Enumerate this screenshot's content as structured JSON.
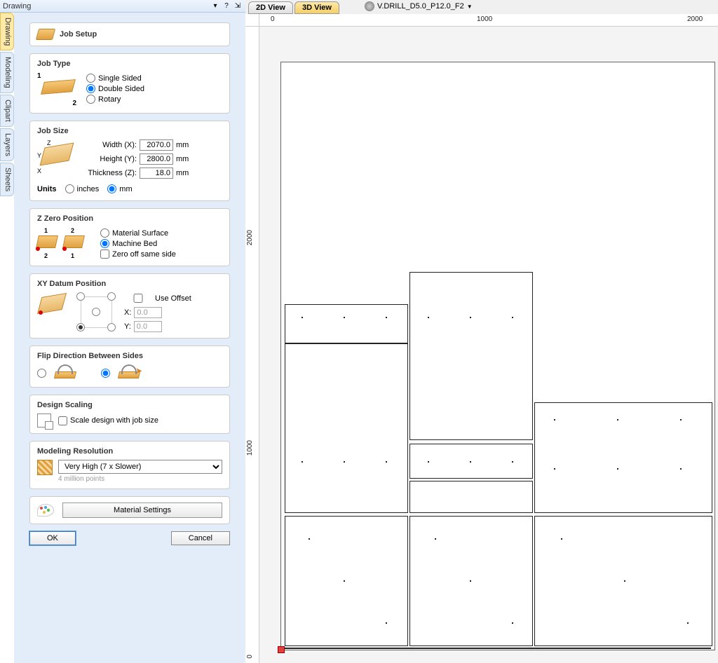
{
  "header": {
    "title": "Drawing"
  },
  "side_tabs": [
    "Drawing",
    "Modeling",
    "Clipart",
    "Layers",
    "Sheets"
  ],
  "job_setup_label": "Job Setup",
  "job_type": {
    "title": "Job Type",
    "single": "Single Sided",
    "double": "Double Sided",
    "rotary": "Rotary",
    "num1": "1",
    "num2": "2"
  },
  "job_size": {
    "title": "Job Size",
    "width_label": "Width (X):",
    "width": "2070.0",
    "height_label": "Height (Y):",
    "height": "2800.0",
    "thickness_label": "Thickness (Z):",
    "thickness": "18.0",
    "unit": "mm",
    "units_label": "Units",
    "inches": "inches",
    "mm": "mm",
    "ax_x": "X",
    "ax_y": "Y",
    "ax_z": "Z"
  },
  "z_zero": {
    "title": "Z Zero Position",
    "surface": "Material Surface",
    "bed": "Machine Bed",
    "same_side": "Zero off same side",
    "n1": "1",
    "n2": "2"
  },
  "datum": {
    "title": "XY Datum Position",
    "use_offset": "Use Offset",
    "x_label": "X:",
    "x": "0.0",
    "y_label": "Y:",
    "y": "0.0"
  },
  "flip": {
    "title": "Flip Direction Between Sides"
  },
  "scaling": {
    "title": "Design Scaling",
    "label": "Scale design with job size"
  },
  "resolution": {
    "title": "Modeling Resolution",
    "value": "Very High (7 x Slower)",
    "sub": "4 million points"
  },
  "material_settings": "Material Settings",
  "ok": "OK",
  "cancel": "Cancel",
  "views": {
    "v2d": "2D View",
    "v3d": "3D View"
  },
  "tool": "V.DRILL_D5.0_P12.0_F2",
  "ruler": {
    "h0": "0",
    "h1000": "1000",
    "h2000": "2000",
    "v1000": "1000",
    "v2000": "2000",
    "v0": "0"
  }
}
